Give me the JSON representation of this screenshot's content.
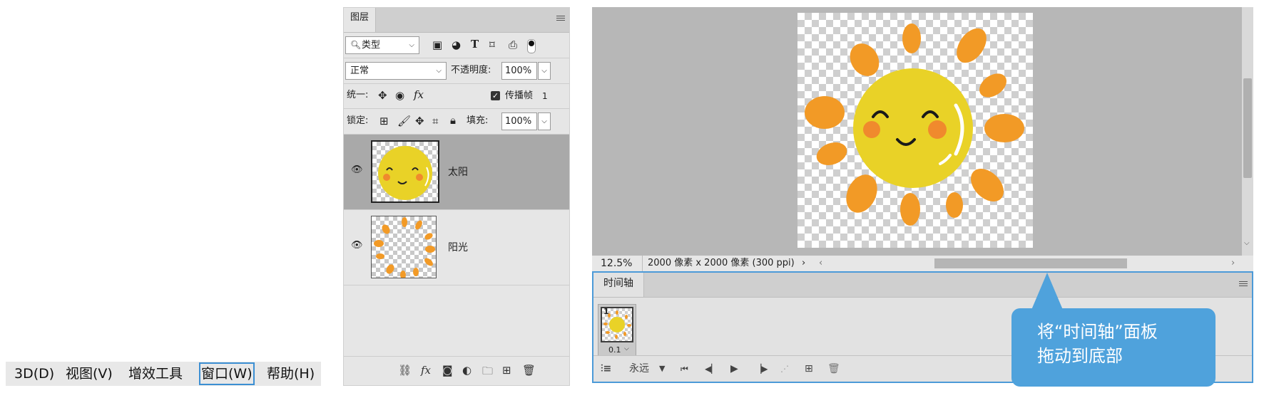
{
  "menubar": {
    "items": [
      {
        "label": "3D(D)"
      },
      {
        "label": "视图(V)"
      },
      {
        "label": "增效工具"
      },
      {
        "label": "窗口(W)",
        "selected": true
      },
      {
        "label": "帮助(H)"
      }
    ],
    "highlight_color": "#3c8fd3"
  },
  "layers_panel": {
    "tab_label": "图层",
    "filter": {
      "label": "类型"
    },
    "blend_mode": "正常",
    "opacity": {
      "label": "不透明度:",
      "value": "100%"
    },
    "unify": {
      "label": "统一:",
      "propagate_label": "传播帧",
      "propagate_value": "1"
    },
    "lock": {
      "label": "锁定:",
      "fill_label": "填充:",
      "fill_value": "100%"
    },
    "layers": [
      {
        "name": "太阳",
        "selected": true
      },
      {
        "name": "阳光",
        "selected": false
      }
    ]
  },
  "document": {
    "zoom": "12.5%",
    "info": "2000 像素 x 2000 像素 (300 ppi)"
  },
  "timeline": {
    "tab_label": "时间轴",
    "frames": [
      {
        "number": "1",
        "delay": "0.1"
      }
    ],
    "loop": "永远"
  },
  "callout": {
    "line1": "将“时间轴”面板",
    "line2": "拖动到底部",
    "color": "#4fa2dc"
  },
  "colors": {
    "sun_yellow": "#e9d227",
    "ray_orange": "#f29a26",
    "cheek": "#f08a2d",
    "panel_bg": "#e6e6e6",
    "selection_blue": "#4c9ad8"
  }
}
